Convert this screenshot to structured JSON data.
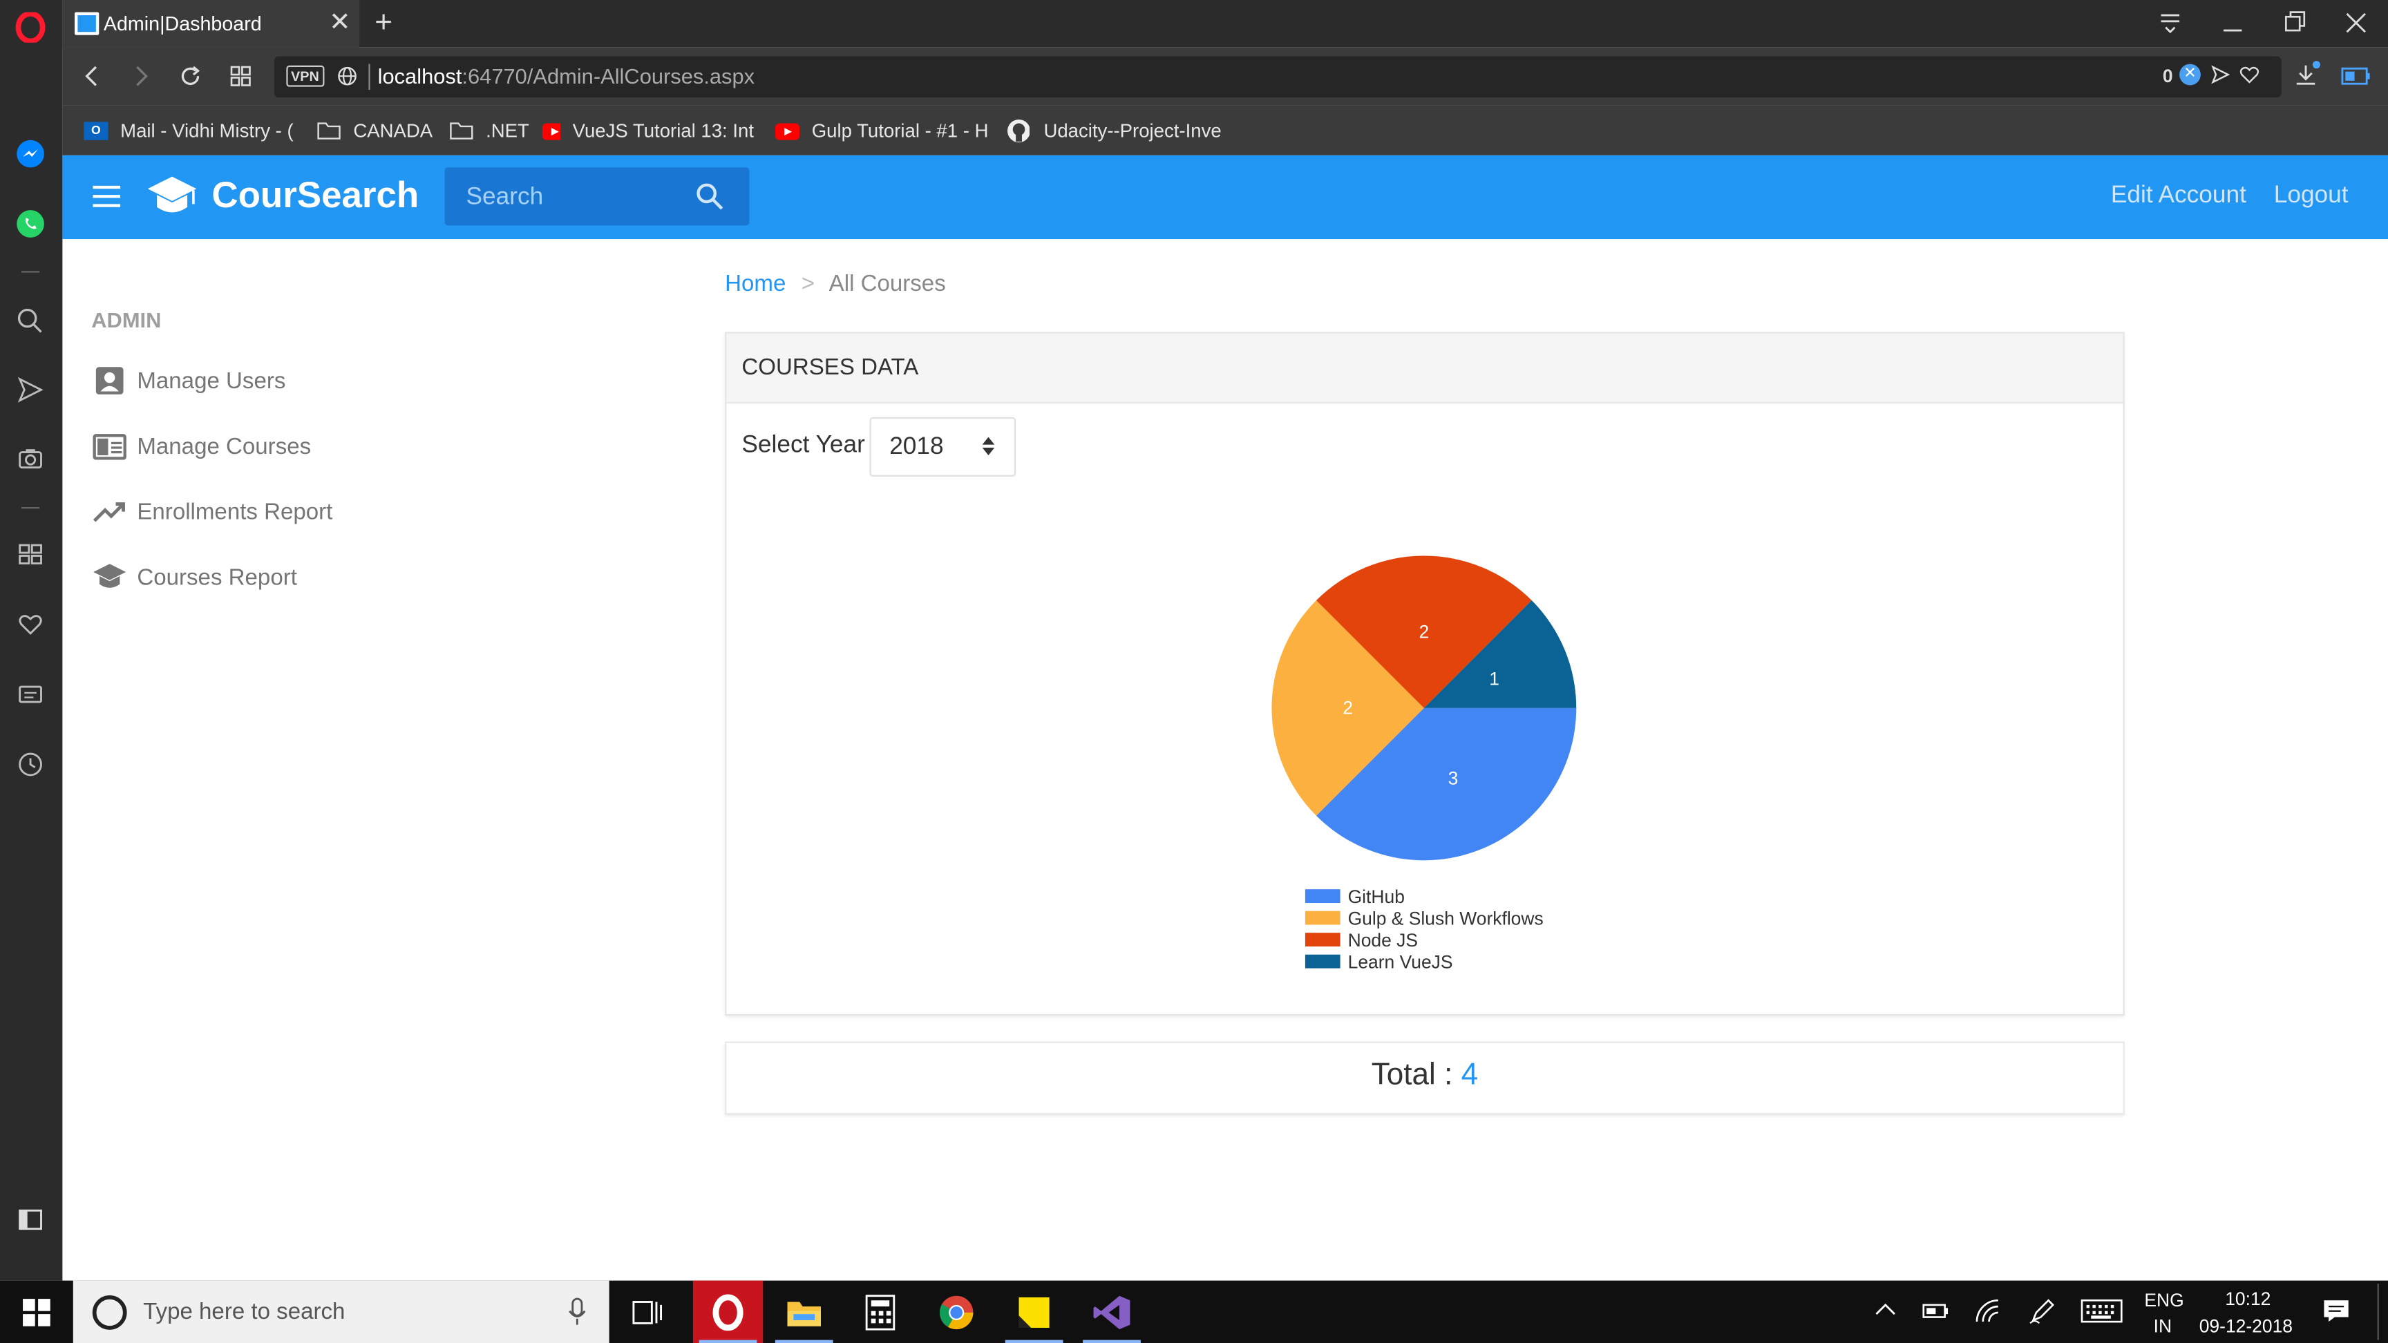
{
  "browser": {
    "tab_title": "Admin|Dashboard",
    "url": "localhost:64770/Admin-AllCourses.aspx",
    "url_host": "localhost",
    "url_rest": ":64770/Admin-AllCourses.aspx",
    "vpn_label": "VPN",
    "adblock_count": "0",
    "bookmarks": [
      {
        "label": "Mail - Vidhi Mistry - (",
        "icon": "outlook-icon"
      },
      {
        "label": "CANADA",
        "icon": "folder-icon"
      },
      {
        "label": ".NET",
        "icon": "folder-icon"
      },
      {
        "label": "VueJS Tutorial 13: Int",
        "icon": "youtube-icon"
      },
      {
        "label": "Gulp Tutorial - #1 - H",
        "icon": "youtube-icon"
      },
      {
        "label": "Udacity--Project-Inve",
        "icon": "github-icon"
      }
    ]
  },
  "header": {
    "brand": "CourSearch",
    "search_placeholder": "Search",
    "edit_account": "Edit Account",
    "logout": "Logout"
  },
  "sidebar": {
    "section": "ADMIN",
    "items": [
      {
        "label": "Manage Users",
        "icon": "user-icon"
      },
      {
        "label": "Manage Courses",
        "icon": "courses-icon"
      },
      {
        "label": "Enrollments Report",
        "icon": "trending-up-icon"
      },
      {
        "label": "Courses Report",
        "icon": "graduation-cap-icon"
      }
    ]
  },
  "breadcrumb": {
    "home": "Home",
    "separator": ">",
    "current": "All Courses"
  },
  "card": {
    "title": "COURSES DATA",
    "select_label": "Select Year",
    "selected_year": "2018"
  },
  "total": {
    "label": "Total : ",
    "value": "4"
  },
  "chart_data": {
    "type": "pie",
    "categories": [
      "GitHub",
      "Gulp & Slush Workflows",
      "Node JS",
      "Learn VueJS"
    ],
    "values": [
      3,
      2,
      2,
      1
    ],
    "colors": [
      "#4285f4",
      "#fbb040",
      "#e2440c",
      "#0a6295"
    ],
    "data_labels": [
      "3",
      "2",
      "2",
      "1"
    ],
    "legend_position": "bottom"
  },
  "taskbar": {
    "search_placeholder": "Type here to search",
    "lang_top": "ENG",
    "lang_bottom": "IN",
    "time": "10:12",
    "date": "09-12-2018"
  }
}
